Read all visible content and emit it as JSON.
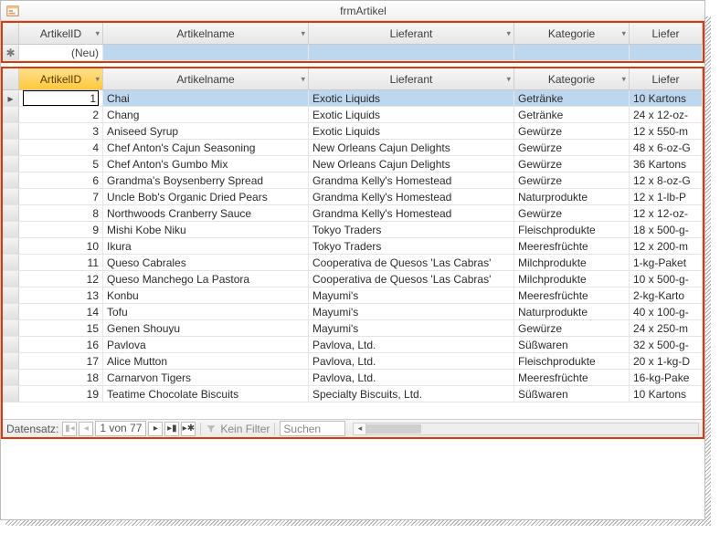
{
  "window": {
    "title": "frmArtikel"
  },
  "columns": {
    "artikelid": "ArtikelID",
    "artikelname": "Artikelname",
    "lieferant": "Lieferant",
    "kategorie": "Kategorie",
    "liefer": "Liefer"
  },
  "new_row": {
    "artikelid_placeholder": "(Neu)"
  },
  "selected_id_display": "1",
  "rows": [
    {
      "id": "1",
      "name": "Chai",
      "lieferant": "Exotic Liquids",
      "kategorie": "Getränke",
      "liefer": "10 Kartons"
    },
    {
      "id": "2",
      "name": "Chang",
      "lieferant": "Exotic Liquids",
      "kategorie": "Getränke",
      "liefer": "24 x 12-oz-"
    },
    {
      "id": "3",
      "name": "Aniseed Syrup",
      "lieferant": "Exotic Liquids",
      "kategorie": "Gewürze",
      "liefer": "12 x 550-m"
    },
    {
      "id": "4",
      "name": "Chef Anton's Cajun Seasoning",
      "lieferant": "New Orleans Cajun Delights",
      "kategorie": "Gewürze",
      "liefer": "48 x 6-oz-G"
    },
    {
      "id": "5",
      "name": "Chef Anton's Gumbo Mix",
      "lieferant": "New Orleans Cajun Delights",
      "kategorie": "Gewürze",
      "liefer": "36 Kartons"
    },
    {
      "id": "6",
      "name": "Grandma's Boysenberry Spread",
      "lieferant": "Grandma Kelly's Homestead",
      "kategorie": "Gewürze",
      "liefer": "12 x 8-oz-G"
    },
    {
      "id": "7",
      "name": "Uncle Bob's Organic Dried Pears",
      "lieferant": "Grandma Kelly's Homestead",
      "kategorie": "Naturprodukte",
      "liefer": "12 x 1-lb-P"
    },
    {
      "id": "8",
      "name": "Northwoods Cranberry Sauce",
      "lieferant": "Grandma Kelly's Homestead",
      "kategorie": "Gewürze",
      "liefer": "12 x 12-oz-"
    },
    {
      "id": "9",
      "name": "Mishi Kobe Niku",
      "lieferant": "Tokyo Traders",
      "kategorie": "Fleischprodukte",
      "liefer": "18 x 500-g-"
    },
    {
      "id": "10",
      "name": "Ikura",
      "lieferant": "Tokyo Traders",
      "kategorie": "Meeresfrüchte",
      "liefer": "12 x 200-m"
    },
    {
      "id": "11",
      "name": "Queso Cabrales",
      "lieferant": "Cooperativa de Quesos 'Las Cabras'",
      "kategorie": "Milchprodukte",
      "liefer": "1-kg-Paket"
    },
    {
      "id": "12",
      "name": "Queso Manchego La Pastora",
      "lieferant": "Cooperativa de Quesos 'Las Cabras'",
      "kategorie": "Milchprodukte",
      "liefer": "10 x 500-g-"
    },
    {
      "id": "13",
      "name": "Konbu",
      "lieferant": "Mayumi's",
      "kategorie": "Meeresfrüchte",
      "liefer": "2-kg-Karto"
    },
    {
      "id": "14",
      "name": "Tofu",
      "lieferant": "Mayumi's",
      "kategorie": "Naturprodukte",
      "liefer": "40 x 100-g-"
    },
    {
      "id": "15",
      "name": "Genen Shouyu",
      "lieferant": "Mayumi's",
      "kategorie": "Gewürze",
      "liefer": "24 x 250-m"
    },
    {
      "id": "16",
      "name": "Pavlova",
      "lieferant": "Pavlova, Ltd.",
      "kategorie": "Süßwaren",
      "liefer": "32 x 500-g-"
    },
    {
      "id": "17",
      "name": "Alice Mutton",
      "lieferant": "Pavlova, Ltd.",
      "kategorie": "Fleischprodukte",
      "liefer": "20 x 1-kg-D"
    },
    {
      "id": "18",
      "name": "Carnarvon Tigers",
      "lieferant": "Pavlova, Ltd.",
      "kategorie": "Meeresfrüchte",
      "liefer": "16-kg-Pake"
    },
    {
      "id": "19",
      "name": "Teatime Chocolate Biscuits",
      "lieferant": "Specialty Biscuits, Ltd.",
      "kategorie": "Süßwaren",
      "liefer": "10 Kartons"
    }
  ],
  "nav": {
    "label": "Datensatz:",
    "record": "1 von 77",
    "filter_off": "Kein Filter",
    "search": "Suchen"
  }
}
